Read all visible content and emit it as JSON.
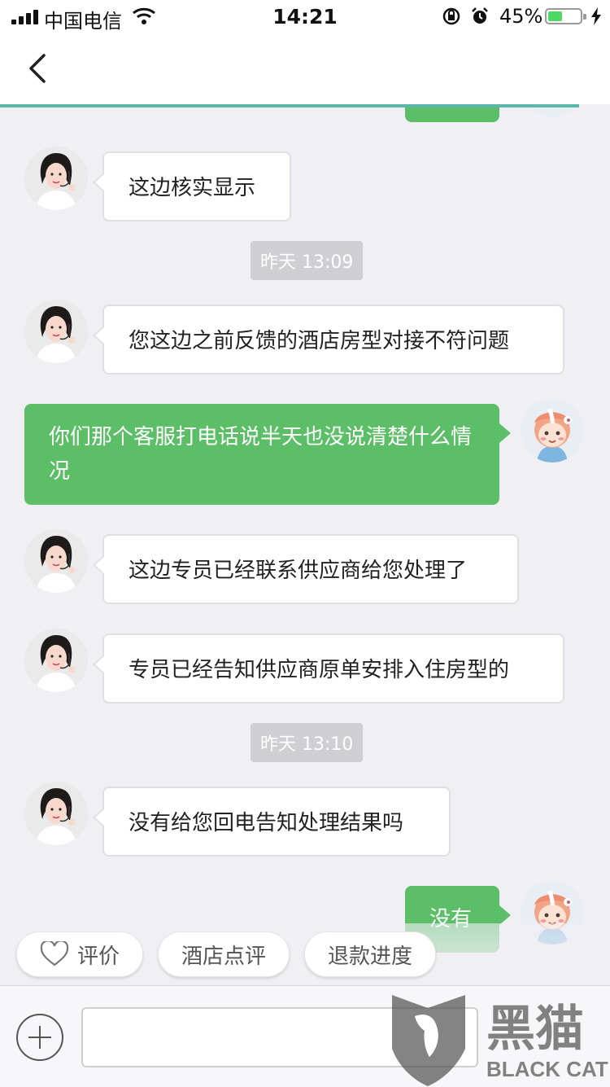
{
  "status_bar": {
    "carrier": "中国电信",
    "time": "14:21",
    "battery_percent": "45%",
    "battery_level": 0.45
  },
  "nav": {
    "back_icon": "chevron-left-icon"
  },
  "messages": [
    {
      "from": "agent",
      "text": "这边核实显示"
    },
    {
      "type": "timestamp",
      "text": "昨天 13:09"
    },
    {
      "from": "agent",
      "text": "您这边之前反馈的酒店房型对接不符问题"
    },
    {
      "from": "user",
      "text": "你们那个客服打电话说半天也没说清楚什么情况"
    },
    {
      "from": "agent",
      "text": "这边专员已经联系供应商给您处理了"
    },
    {
      "from": "agent",
      "text": "专员已经告知供应商原单安排入住房型的"
    },
    {
      "type": "timestamp",
      "text": "昨天 13:10"
    },
    {
      "from": "agent",
      "text": "没有给您回电告知处理结果吗"
    },
    {
      "from": "user",
      "text": "没有"
    }
  ],
  "quick_actions": [
    {
      "label": "评价",
      "icon": "heart-icon"
    },
    {
      "label": "酒店点评"
    },
    {
      "label": "退款进度"
    }
  ],
  "input": {
    "placeholder": ""
  },
  "watermark": {
    "cn": "黑猫",
    "en": "BLACK CAT"
  },
  "colors": {
    "user_bubble": "#5dbe68",
    "agent_bubble": "#ffffff",
    "background": "#efeff4",
    "nav_accent": "#5bb8a8"
  }
}
